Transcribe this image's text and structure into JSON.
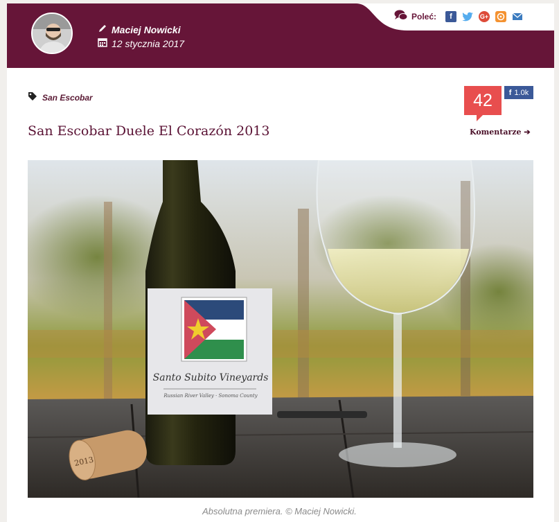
{
  "author": {
    "name": "Maciej Nowicki",
    "date": "12 stycznia 2017"
  },
  "share": {
    "label": "Poleć:",
    "icons": [
      "facebook-icon",
      "twitter-icon",
      "google-plus-icon",
      "wykop-icon",
      "email-icon"
    ]
  },
  "post": {
    "tag": "San Escobar",
    "title": "San Escobar Duele El Corazón 2013",
    "comment_count": "42",
    "facebook_count": "1.0k",
    "comments_link": "Komentarze ➔"
  },
  "photo": {
    "label_text": "Santo Subito Vineyards",
    "label_subtext": "Russian River Valley · Sonoma County",
    "cork_text": "2013",
    "caption": "Absolutna premiera. © Maciej Nowicki."
  },
  "colors": {
    "brand": "#661538",
    "accent": "#e84e4e",
    "facebook": "#3b5998",
    "twitter": "#55acee",
    "google": "#dd4b39",
    "wykop": "#f49231",
    "email": "#3b7bbf"
  }
}
